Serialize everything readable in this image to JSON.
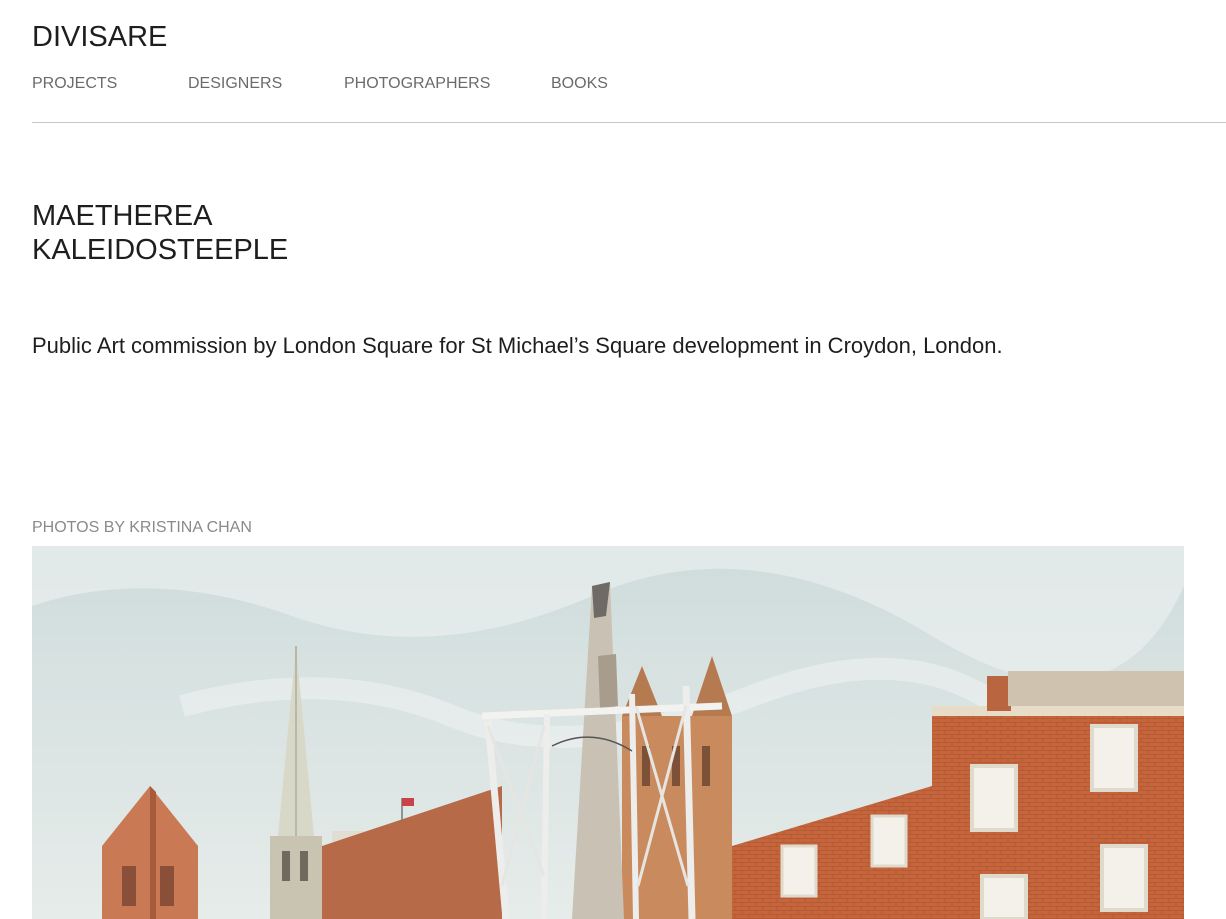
{
  "site": {
    "logo": "DIVISARE"
  },
  "nav": {
    "items": [
      {
        "label": "PROJECTS"
      },
      {
        "label": "DESIGNERS"
      },
      {
        "label": "PHOTOGRAPHERS"
      },
      {
        "label": "BOOKS"
      }
    ]
  },
  "project": {
    "title_line1": "MAETHEREA",
    "title_line2": "KALEIDOSTEEPLE",
    "description": "Public Art commission by London Square for St Michael’s Square development in Croydon, London.",
    "photo_credit": "PHOTOS BY KRISTINA CHAN"
  },
  "colors": {
    "text": "#1e1e1e",
    "nav_text": "#6b6b6b",
    "credit_text": "#8a8a8a",
    "divider": "#c8c8c8",
    "sky": "#dce6e6",
    "brick": "#c2643c"
  }
}
